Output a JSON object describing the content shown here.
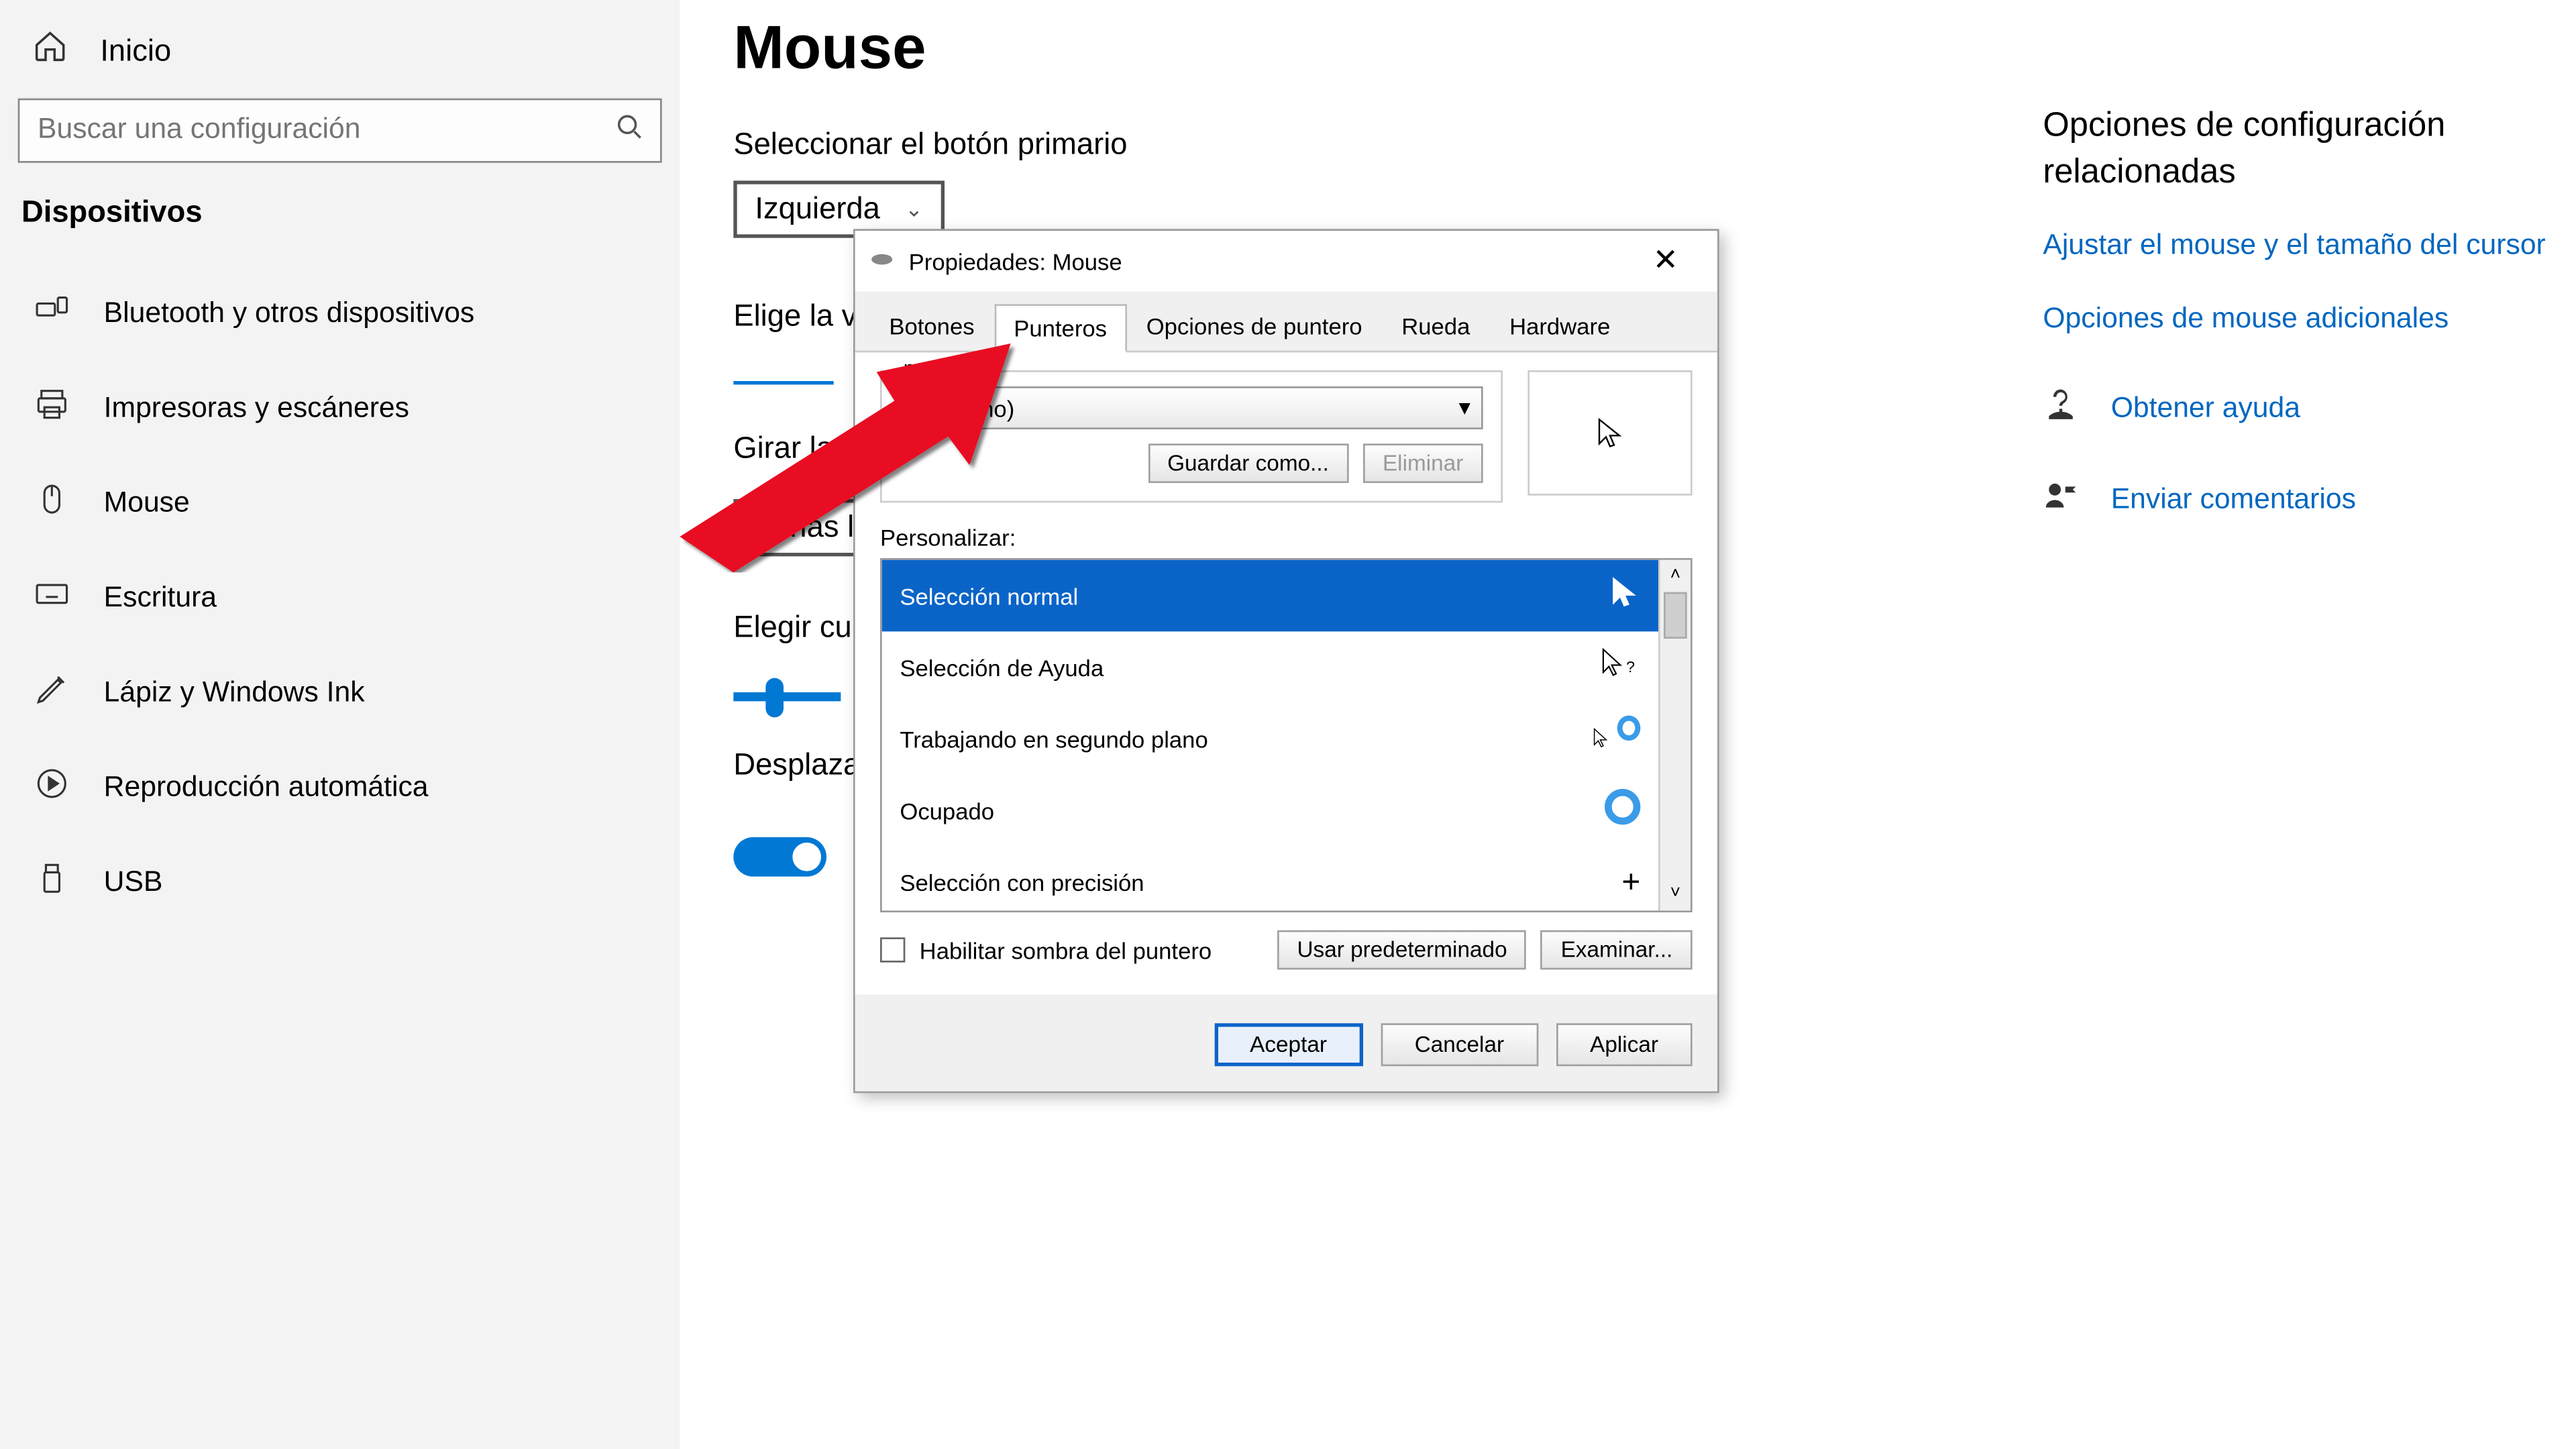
{
  "sidebar": {
    "home": "Inicio",
    "search_placeholder": "Buscar una configuración",
    "category": "Dispositivos",
    "items": [
      {
        "label": "Bluetooth y otros dispositivos"
      },
      {
        "label": "Impresoras y escáneres"
      },
      {
        "label": "Mouse"
      },
      {
        "label": "Escritura"
      },
      {
        "label": "Lápiz y Windows Ink"
      },
      {
        "label": "Reproducción automática"
      },
      {
        "label": "USB"
      }
    ]
  },
  "main": {
    "title": "Mouse",
    "primary_btn_label": "Seleccionar el botón primario",
    "primary_btn_value": "Izquierda",
    "speed_label": "Elige la v",
    "rotate_label": "Girar la r",
    "rotate_value": "Varias l",
    "lines_label": "Elegir cu",
    "scroll_label": "Desplaza"
  },
  "right": {
    "title": "Opciones de configuración relacionadas",
    "link1": "Ajustar el mouse y el tamaño del cursor",
    "link2": "Opciones de mouse adicionales",
    "help": "Obtener ayuda",
    "feedback": "Enviar comentarios"
  },
  "dialog": {
    "title": "Propiedades: Mouse",
    "tabs": [
      "Botones",
      "Punteros",
      "Opciones de puntero",
      "Rueda",
      "Hardware"
    ],
    "active_tab": "Punteros",
    "scheme_legend": "ma",
    "scheme_value": "(Ninguno)",
    "save_as": "Guardar como...",
    "delete": "Eliminar",
    "customize_label": "Personalizar:",
    "cursors": [
      {
        "label": "Selección normal"
      },
      {
        "label": "Selección de Ayuda"
      },
      {
        "label": "Trabajando en segundo plano"
      },
      {
        "label": "Ocupado"
      },
      {
        "label": "Selección con precisión"
      }
    ],
    "shadow": "Habilitar sombra del puntero",
    "use_default": "Usar predeterminado",
    "browse": "Examinar...",
    "ok": "Aceptar",
    "cancel": "Cancelar",
    "apply": "Aplicar"
  }
}
